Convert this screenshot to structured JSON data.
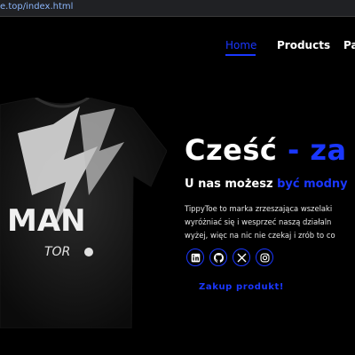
{
  "browser": {
    "url": "e.top/index.html"
  },
  "nav": {
    "items": [
      {
        "label": "Home"
      },
      {
        "label": "Products"
      },
      {
        "label": "Pa"
      }
    ]
  },
  "hero": {
    "headline_main": "Cześć",
    "headline_accent": " - za",
    "subhead_main": "U nas możesz ",
    "subhead_accent": "być modny",
    "paragraph": [
      "TippyToe to marka zrzeszająca wszelaki",
      "wyróżniać się i wesprzeć naszą działaln",
      "wyżej, więc na nic nie czekaj i zrób to co"
    ],
    "shirt_print_top": "MAN",
    "shirt_print_bottom": "TOR",
    "cta_label": "Zakup produkt!"
  },
  "socials": [
    {
      "icon": "linkedin-icon"
    },
    {
      "icon": "github-icon"
    },
    {
      "icon": "x-icon"
    },
    {
      "icon": "instagram-icon"
    }
  ],
  "colors": {
    "accent": "#1a37ff",
    "background": "#000000",
    "text": "#ffffff"
  }
}
